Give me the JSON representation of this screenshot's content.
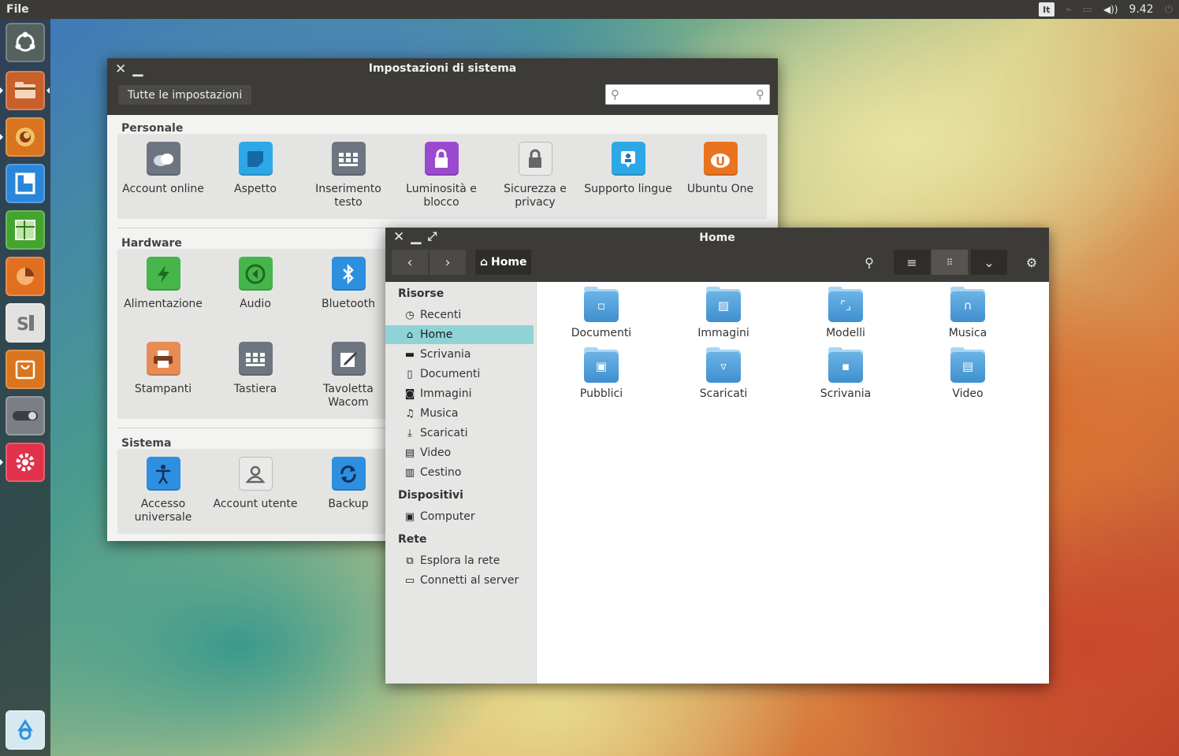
{
  "top_panel": {
    "app_menu": "File",
    "keyboard_layout": "It",
    "volume_icon": "◀))",
    "clock": "9.42"
  },
  "launcher": {
    "items": [
      {
        "name": "ubuntu-dash-icon",
        "color": "#5a6a6a"
      },
      {
        "name": "files-icon",
        "color": "#d36b2f"
      },
      {
        "name": "firefox-icon",
        "color": "#e07a1f"
      },
      {
        "name": "libreoffice-writer-icon",
        "color": "#2a86d8"
      },
      {
        "name": "libreoffice-calc-icon",
        "color": "#43a52f"
      },
      {
        "name": "libreoffice-impress-icon",
        "color": "#e06f1f"
      },
      {
        "name": "software-center-icon",
        "color": "#e1e1df"
      },
      {
        "name": "ubuntu-one-music-icon",
        "color": "#e07a1f"
      },
      {
        "name": "system-toggle-icon",
        "color": "#7a7f86"
      },
      {
        "name": "system-settings-icon",
        "color": "#e0324a"
      },
      {
        "name": "trash-icon",
        "color": "#d8eaf2"
      }
    ]
  },
  "settings_window": {
    "title": "Impostazioni di sistema",
    "all_settings_button": "Tutte le impostazioni",
    "search_placeholder": "",
    "sections": {
      "personal": {
        "label": "Personale",
        "items": [
          {
            "label": "Account online",
            "icon": "cloud-icon",
            "color": "#6d7680"
          },
          {
            "label": "Aspetto",
            "icon": "appearance-icon",
            "color": "#2da8e6"
          },
          {
            "label": "Inserimento testo",
            "icon": "keyboard-icon",
            "color": "#6d7680"
          },
          {
            "label": "Luminosità e blocco",
            "icon": "lock-icon",
            "color": "#9b4ad0"
          },
          {
            "label": "Sicurezza e privacy",
            "icon": "privacy-icon",
            "color": "#e9e9e7"
          },
          {
            "label": "Supporto lingue",
            "icon": "language-icon",
            "color": "#2da8e6"
          },
          {
            "label": "Ubuntu One",
            "icon": "ubuntu-one-icon",
            "color": "#e9731f"
          }
        ]
      },
      "hardware": {
        "label": "Hardware",
        "items": [
          {
            "label": "Alimentazione",
            "icon": "power-icon",
            "color": "#46b54a"
          },
          {
            "label": "Audio",
            "icon": "audio-icon",
            "color": "#46b54a"
          },
          {
            "label": "Bluetooth",
            "icon": "bluetooth-icon",
            "color": "#2d8fe0"
          },
          {
            "label": "Stampanti",
            "icon": "printer-icon",
            "color": "#e98b55"
          },
          {
            "label": "Tastiera",
            "icon": "keyboard-icon",
            "color": "#6d7680"
          },
          {
            "label": "Tavoletta Wacom",
            "icon": "tablet-icon",
            "color": "#6d7680"
          }
        ]
      },
      "system": {
        "label": "Sistema",
        "items": [
          {
            "label": "Accesso universale",
            "icon": "accessibility-icon",
            "color": "#2d8fe0"
          },
          {
            "label": "Account utente",
            "icon": "user-icon",
            "color": "#e9e9e7"
          },
          {
            "label": "Backup",
            "icon": "backup-icon",
            "color": "#2d8fe0"
          }
        ]
      }
    }
  },
  "files_window": {
    "title": "Home",
    "path_button": "Home",
    "sidebar": {
      "resources_label": "Risorse",
      "resources": [
        {
          "label": "Recenti",
          "icon": "◷"
        },
        {
          "label": "Home",
          "icon": "⌂"
        },
        {
          "label": "Scrivania",
          "icon": "▬"
        },
        {
          "label": "Documenti",
          "icon": "▯"
        },
        {
          "label": "Immagini",
          "icon": "◙"
        },
        {
          "label": "Musica",
          "icon": "♫"
        },
        {
          "label": "Scaricati",
          "icon": "⤓"
        },
        {
          "label": "Video",
          "icon": "▤"
        },
        {
          "label": "Cestino",
          "icon": "▥"
        }
      ],
      "devices_label": "Dispositivi",
      "devices": [
        {
          "label": "Computer",
          "icon": "▣"
        }
      ],
      "network_label": "Rete",
      "network": [
        {
          "label": "Esplora la rete",
          "icon": "⧉"
        },
        {
          "label": "Connetti al server",
          "icon": "▭"
        }
      ]
    },
    "folders": [
      {
        "label": "Documenti",
        "glyph": "▫"
      },
      {
        "label": "Immagini",
        "glyph": "▨"
      },
      {
        "label": "Modelli",
        "glyph": "⌜⌟"
      },
      {
        "label": "Musica",
        "glyph": "∩"
      },
      {
        "label": "Pubblici",
        "glyph": "▣"
      },
      {
        "label": "Scaricati",
        "glyph": "▿"
      },
      {
        "label": "Scrivania",
        "glyph": "▪"
      },
      {
        "label": "Video",
        "glyph": "▤"
      }
    ]
  }
}
